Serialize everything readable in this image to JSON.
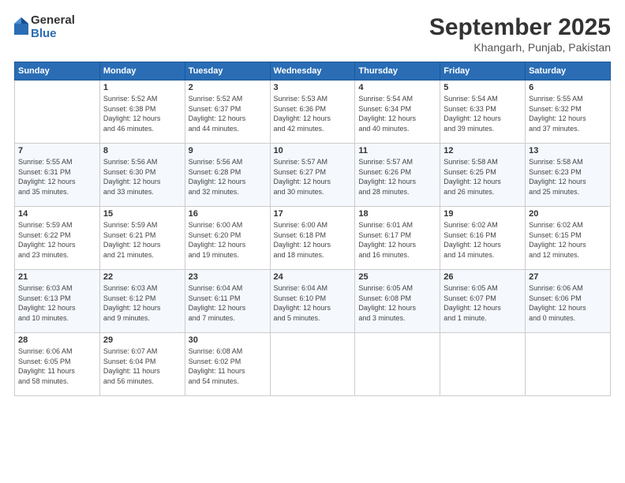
{
  "logo": {
    "general": "General",
    "blue": "Blue"
  },
  "header": {
    "month": "September 2025",
    "location": "Khangarh, Punjab, Pakistan"
  },
  "weekdays": [
    "Sunday",
    "Monday",
    "Tuesday",
    "Wednesday",
    "Thursday",
    "Friday",
    "Saturday"
  ],
  "weeks": [
    [
      {
        "day": "",
        "detail": ""
      },
      {
        "day": "1",
        "detail": "Sunrise: 5:52 AM\nSunset: 6:38 PM\nDaylight: 12 hours\nand 46 minutes."
      },
      {
        "day": "2",
        "detail": "Sunrise: 5:52 AM\nSunset: 6:37 PM\nDaylight: 12 hours\nand 44 minutes."
      },
      {
        "day": "3",
        "detail": "Sunrise: 5:53 AM\nSunset: 6:36 PM\nDaylight: 12 hours\nand 42 minutes."
      },
      {
        "day": "4",
        "detail": "Sunrise: 5:54 AM\nSunset: 6:34 PM\nDaylight: 12 hours\nand 40 minutes."
      },
      {
        "day": "5",
        "detail": "Sunrise: 5:54 AM\nSunset: 6:33 PM\nDaylight: 12 hours\nand 39 minutes."
      },
      {
        "day": "6",
        "detail": "Sunrise: 5:55 AM\nSunset: 6:32 PM\nDaylight: 12 hours\nand 37 minutes."
      }
    ],
    [
      {
        "day": "7",
        "detail": "Sunrise: 5:55 AM\nSunset: 6:31 PM\nDaylight: 12 hours\nand 35 minutes."
      },
      {
        "day": "8",
        "detail": "Sunrise: 5:56 AM\nSunset: 6:30 PM\nDaylight: 12 hours\nand 33 minutes."
      },
      {
        "day": "9",
        "detail": "Sunrise: 5:56 AM\nSunset: 6:28 PM\nDaylight: 12 hours\nand 32 minutes."
      },
      {
        "day": "10",
        "detail": "Sunrise: 5:57 AM\nSunset: 6:27 PM\nDaylight: 12 hours\nand 30 minutes."
      },
      {
        "day": "11",
        "detail": "Sunrise: 5:57 AM\nSunset: 6:26 PM\nDaylight: 12 hours\nand 28 minutes."
      },
      {
        "day": "12",
        "detail": "Sunrise: 5:58 AM\nSunset: 6:25 PM\nDaylight: 12 hours\nand 26 minutes."
      },
      {
        "day": "13",
        "detail": "Sunrise: 5:58 AM\nSunset: 6:23 PM\nDaylight: 12 hours\nand 25 minutes."
      }
    ],
    [
      {
        "day": "14",
        "detail": "Sunrise: 5:59 AM\nSunset: 6:22 PM\nDaylight: 12 hours\nand 23 minutes."
      },
      {
        "day": "15",
        "detail": "Sunrise: 5:59 AM\nSunset: 6:21 PM\nDaylight: 12 hours\nand 21 minutes."
      },
      {
        "day": "16",
        "detail": "Sunrise: 6:00 AM\nSunset: 6:20 PM\nDaylight: 12 hours\nand 19 minutes."
      },
      {
        "day": "17",
        "detail": "Sunrise: 6:00 AM\nSunset: 6:18 PM\nDaylight: 12 hours\nand 18 minutes."
      },
      {
        "day": "18",
        "detail": "Sunrise: 6:01 AM\nSunset: 6:17 PM\nDaylight: 12 hours\nand 16 minutes."
      },
      {
        "day": "19",
        "detail": "Sunrise: 6:02 AM\nSunset: 6:16 PM\nDaylight: 12 hours\nand 14 minutes."
      },
      {
        "day": "20",
        "detail": "Sunrise: 6:02 AM\nSunset: 6:15 PM\nDaylight: 12 hours\nand 12 minutes."
      }
    ],
    [
      {
        "day": "21",
        "detail": "Sunrise: 6:03 AM\nSunset: 6:13 PM\nDaylight: 12 hours\nand 10 minutes."
      },
      {
        "day": "22",
        "detail": "Sunrise: 6:03 AM\nSunset: 6:12 PM\nDaylight: 12 hours\nand 9 minutes."
      },
      {
        "day": "23",
        "detail": "Sunrise: 6:04 AM\nSunset: 6:11 PM\nDaylight: 12 hours\nand 7 minutes."
      },
      {
        "day": "24",
        "detail": "Sunrise: 6:04 AM\nSunset: 6:10 PM\nDaylight: 12 hours\nand 5 minutes."
      },
      {
        "day": "25",
        "detail": "Sunrise: 6:05 AM\nSunset: 6:08 PM\nDaylight: 12 hours\nand 3 minutes."
      },
      {
        "day": "26",
        "detail": "Sunrise: 6:05 AM\nSunset: 6:07 PM\nDaylight: 12 hours\nand 1 minute."
      },
      {
        "day": "27",
        "detail": "Sunrise: 6:06 AM\nSunset: 6:06 PM\nDaylight: 12 hours\nand 0 minutes."
      }
    ],
    [
      {
        "day": "28",
        "detail": "Sunrise: 6:06 AM\nSunset: 6:05 PM\nDaylight: 11 hours\nand 58 minutes."
      },
      {
        "day": "29",
        "detail": "Sunrise: 6:07 AM\nSunset: 6:04 PM\nDaylight: 11 hours\nand 56 minutes."
      },
      {
        "day": "30",
        "detail": "Sunrise: 6:08 AM\nSunset: 6:02 PM\nDaylight: 11 hours\nand 54 minutes."
      },
      {
        "day": "",
        "detail": ""
      },
      {
        "day": "",
        "detail": ""
      },
      {
        "day": "",
        "detail": ""
      },
      {
        "day": "",
        "detail": ""
      }
    ]
  ]
}
